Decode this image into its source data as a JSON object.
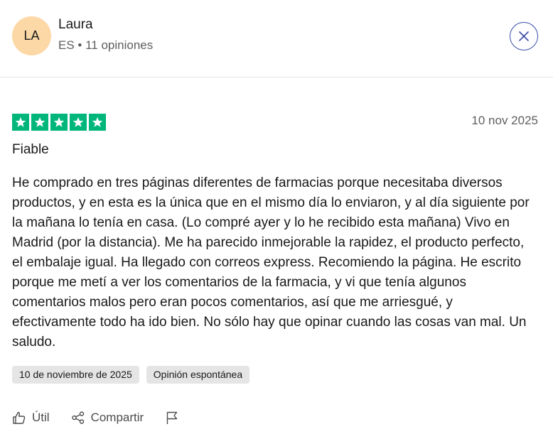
{
  "user": {
    "initials": "LA",
    "name": "Laura",
    "meta": "ES • 11 opiniones",
    "avatar_color": "#fdd8a7"
  },
  "close_button": {
    "icon": "close-icon",
    "color": "#3a4aa6"
  },
  "review": {
    "rating": 5,
    "max_rating": 5,
    "star_color": "#00b67a",
    "date": "10 nov 2025",
    "title": "Fiable",
    "body": "He comprado en tres páginas diferentes de farmacias porque necesitaba diversos productos, y en esta es la única que en el mismo día lo enviaron, y al día siguiente por la mañana lo tenía en casa. (Lo compré ayer y lo he recibido esta mañana) Vivo en Madrid (por la distancia). Me ha parecido inmejorable la rapidez, el producto perfecto, el embalaje igual. Ha llegado con correos express. Recomiendo la página. He escrito porque me metí a ver los comentarios de la farmacia, y vi que tenía algunos comentarios malos pero eran pocos comentarios, así que me arriesgué, y efectivamente todo ha ido bien. No sólo hay que opinar cuando las cosas van mal. Un saludo.",
    "tags": [
      "10 de noviembre de 2025",
      "Opinión espontánea"
    ]
  },
  "actions": {
    "useful_label": "Útil",
    "share_label": "Compartir",
    "useful_icon": "thumbs-up-icon",
    "share_icon": "share-icon",
    "report_icon": "flag-icon"
  }
}
